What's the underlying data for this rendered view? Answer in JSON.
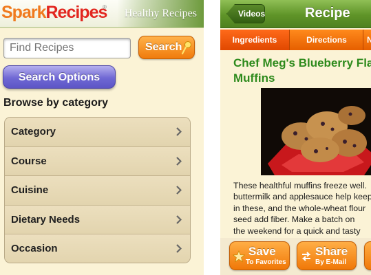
{
  "left_screen": {
    "header": {
      "logo_spark": "Spark",
      "logo_recipes": "Recipes",
      "tagline": "Healthy Recipes"
    },
    "search": {
      "placeholder": "Find Recipes",
      "button_label": "Search"
    },
    "search_options_label": "Search Options",
    "browse_heading": "Browse by category",
    "categories": [
      {
        "label": "Category"
      },
      {
        "label": "Course"
      },
      {
        "label": "Cuisine"
      },
      {
        "label": "Dietary Needs"
      },
      {
        "label": "Occasion"
      }
    ]
  },
  "right_screen": {
    "nav": {
      "back_label": "Videos",
      "title": "Recipe"
    },
    "tabs": [
      {
        "label": "Ingredients",
        "active": true
      },
      {
        "label": "Directions",
        "active": false
      },
      {
        "label": "Nutrition",
        "active": false
      }
    ],
    "recipe": {
      "title": "Chef Meg's Blueberry Flax\nMuffins",
      "description": "These healthful muffins freeze well.\nbuttermilk and applesauce help keep\nin these, and the whole-wheat flour\nseed add fiber. Make a batch on\nthe weekend for a quick and tasty"
    },
    "actions": {
      "save_main": "Save",
      "save_sub": "To Favorites",
      "share_main": "Share",
      "share_sub": "By E-Mail"
    }
  },
  "colors": {
    "orange_button": "#f07b0c",
    "green_nav": "#5f9428",
    "title_green": "#2d8a1c",
    "cream_bg": "#fbf3d6",
    "purple_button": "#6f68d4"
  }
}
